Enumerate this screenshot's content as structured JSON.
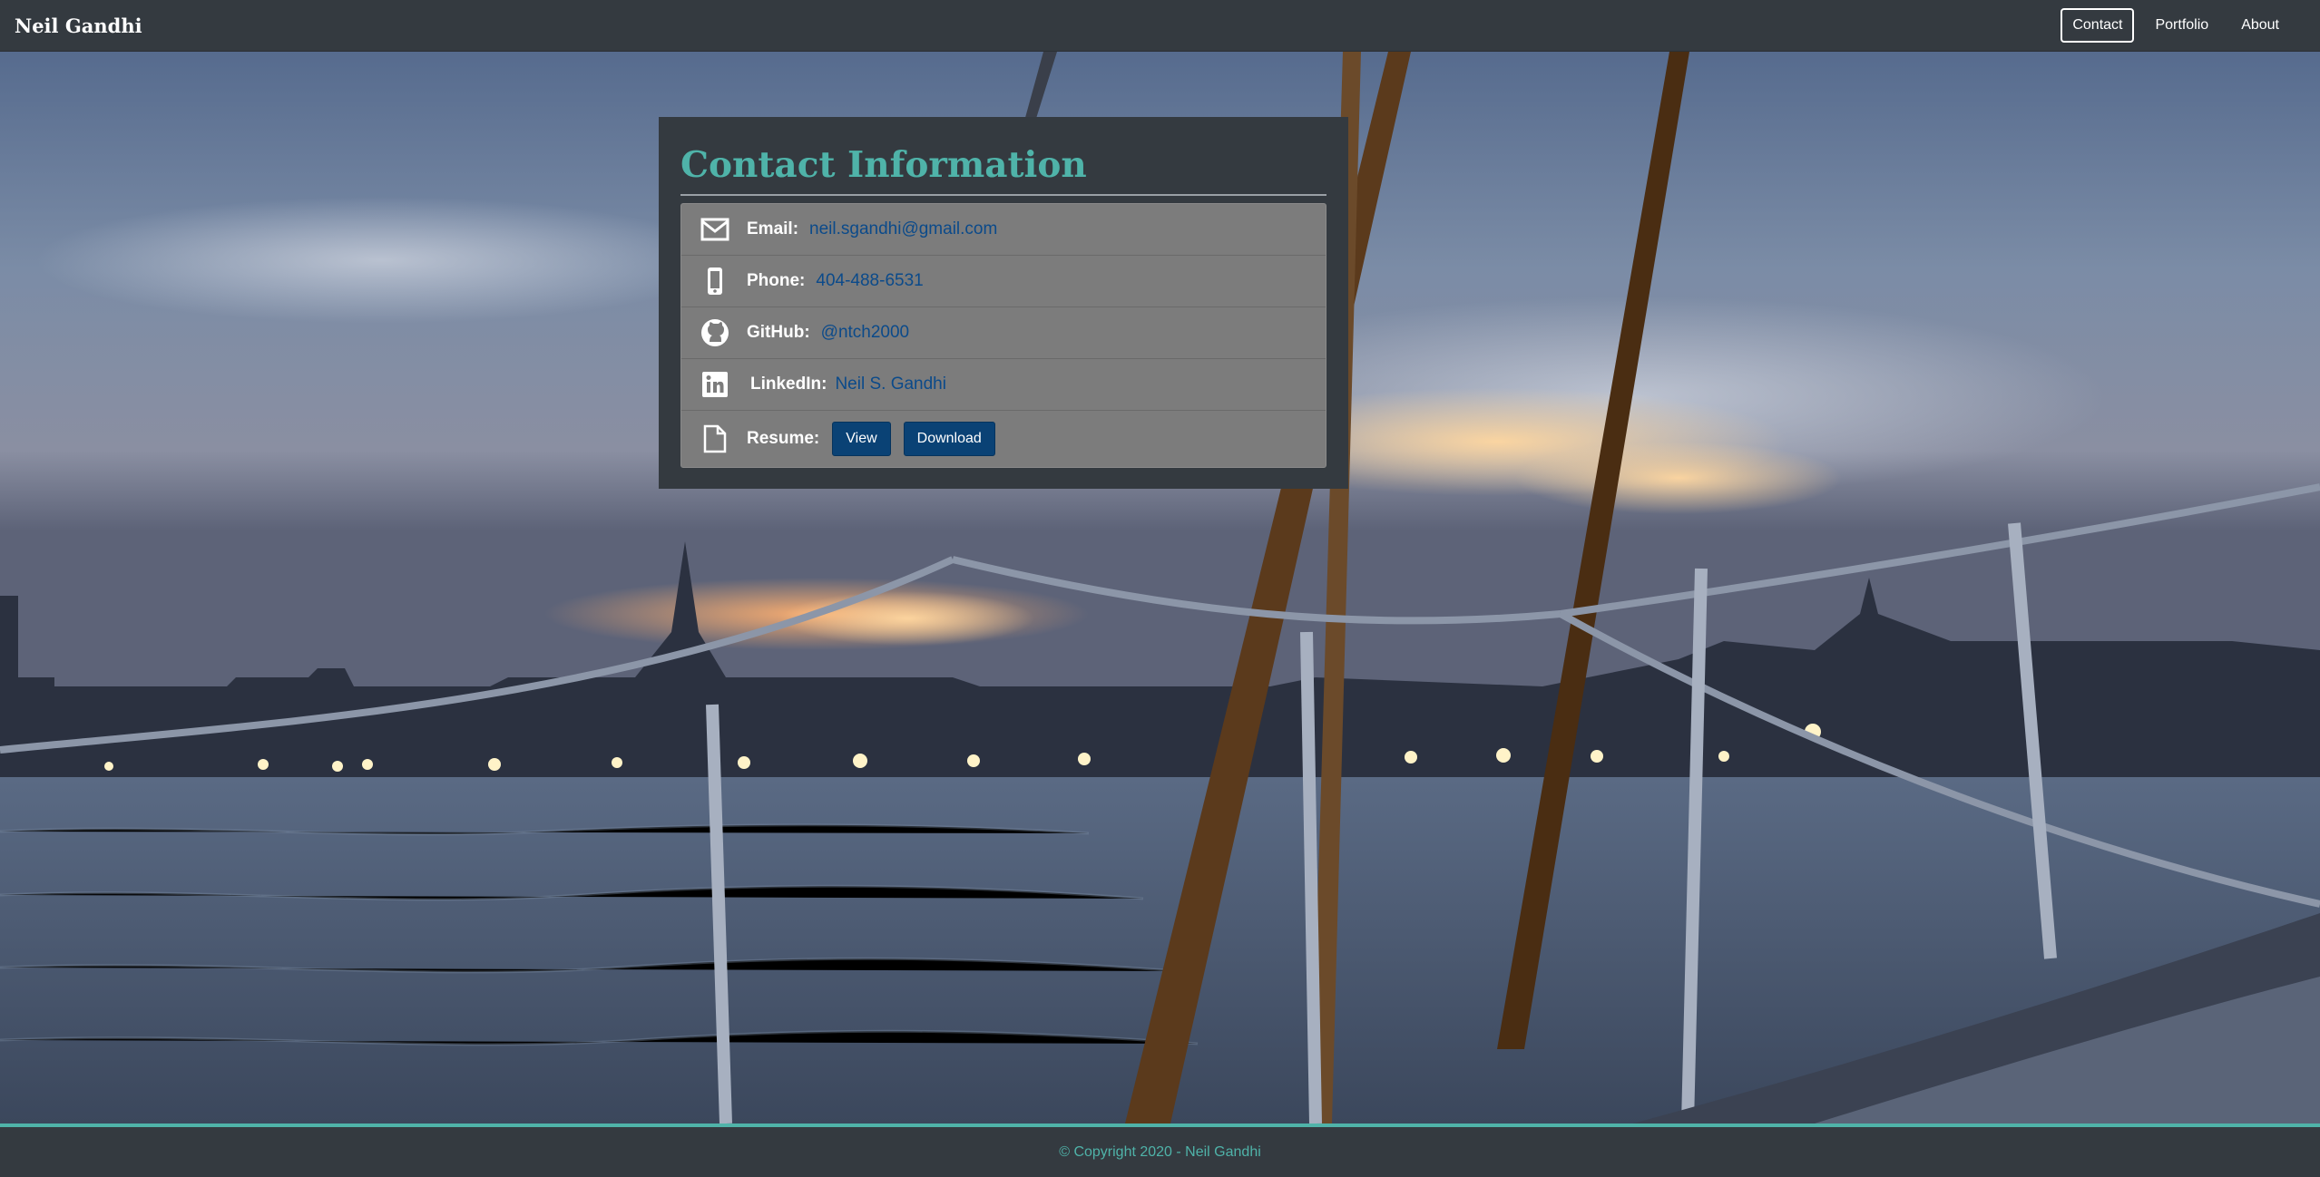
{
  "navbar": {
    "brand": "Neil Gandhi",
    "links": [
      {
        "label": "Contact",
        "active": true
      },
      {
        "label": "Portfolio",
        "active": false
      },
      {
        "label": "About",
        "active": false
      }
    ]
  },
  "contact": {
    "title": "Contact Information",
    "rows": [
      {
        "icon": "envelope-icon",
        "label": "Email:",
        "value": "neil.sgandhi@gmail.com"
      },
      {
        "icon": "mobile-phone-icon",
        "label": "Phone:",
        "value": "404-488-6531"
      },
      {
        "icon": "github-icon",
        "label": "GitHub:",
        "value": "@ntch2000"
      },
      {
        "icon": "linkedin-icon",
        "label": "LinkedIn:",
        "value": "Neil S. Gandhi"
      },
      {
        "icon": "document-icon",
        "label": "Resume:",
        "buttons": [
          "View",
          "Download"
        ]
      }
    ]
  },
  "footer": {
    "text": "© Copyright 2020 - Neil Gandhi"
  },
  "colors": {
    "accent": "#4fb3a9",
    "link": "#0b4a8a",
    "button": "#0a4275",
    "dark": "#343a40"
  }
}
